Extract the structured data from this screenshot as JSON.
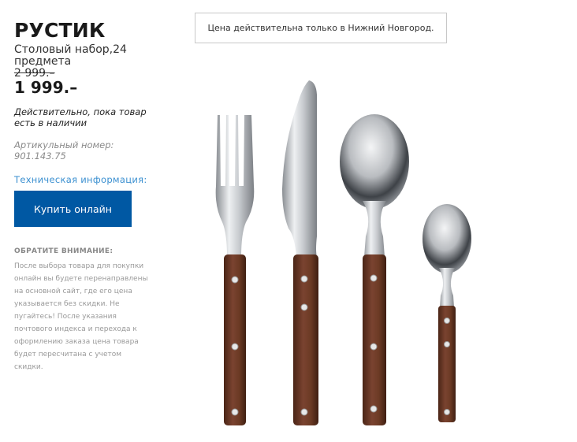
{
  "product": {
    "name": "РУСТИК",
    "subtitle": "Столовый набор,24 предмета",
    "old_price": "2 999.–",
    "price": "1 999.–",
    "availability": "Действительно, пока товар есть в наличии",
    "article": "Артикульный номер: 901.143.75",
    "tech_info_link": "Техническая информация:",
    "buy_button": "Купить онлайн",
    "image_icon": "cutlery-set-image"
  },
  "notice": {
    "title": "ОБРАТИТЕ ВНИМАНИЕ:",
    "text": "После выбора товара для покупки онлайн вы будете перенаправлены на основной сайт, где его цена указывается без скидки. Не пугайтесь! После указания почтового индекса и перехода к оформлению заказа цена товара будет пересчитана с учетом скидки."
  },
  "city_notice": "Цена действительна только в Нижний Новгород.",
  "colors": {
    "button_bg": "#0058a3",
    "link": "#3a8fd0",
    "wood": "#6b3a24"
  }
}
